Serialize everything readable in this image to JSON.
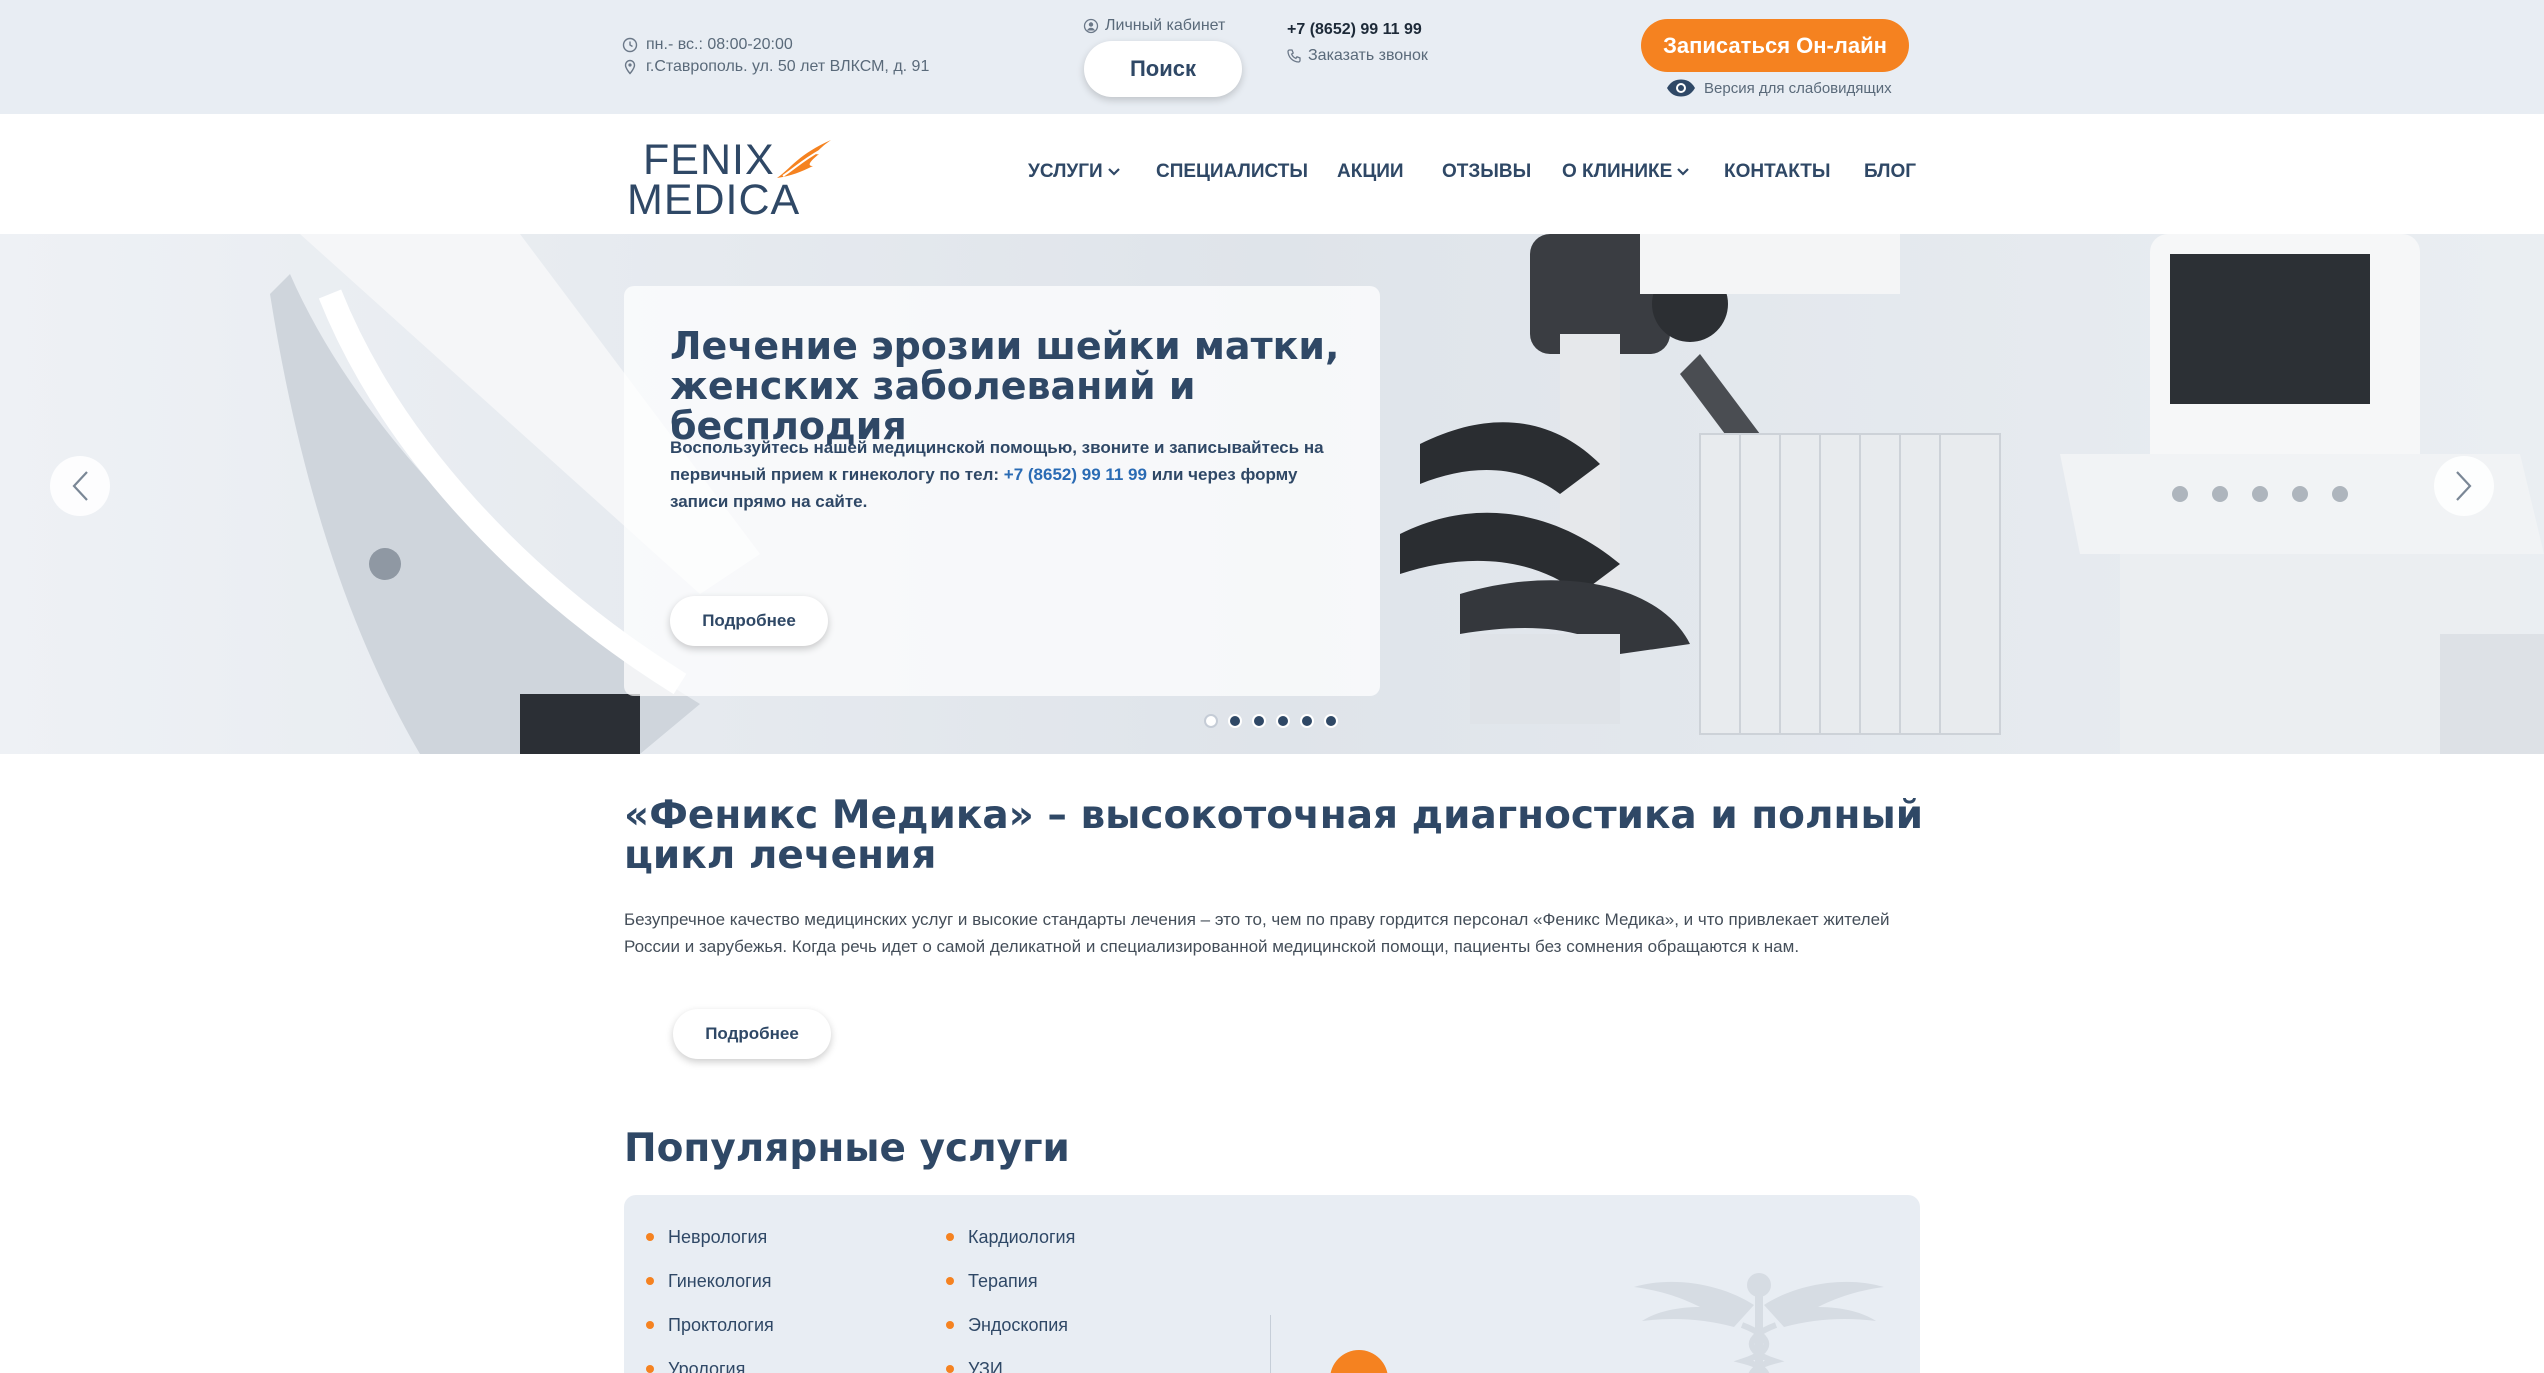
{
  "topbar": {
    "hours": "пн.- вс.: 08:00-20:00",
    "address": "г.Ставрополь. ул. 50 лет ВЛКСМ, д. 91",
    "cabinet_label": "Личный кабинет",
    "search_label": "Поиск",
    "phone": "+7 (8652) 99 11 99",
    "callback_label": "Заказать звонок",
    "online_label": "Записаться Он-лайн",
    "vision_label": "Версия для слабовидящих"
  },
  "logo": {
    "line1": "FENIX",
    "line2": "MEDICA"
  },
  "nav": {
    "items": [
      {
        "label": "УСЛУГИ"
      },
      {
        "label": "СПЕЦИАЛИСТЫ"
      },
      {
        "label": "АКЦИИ"
      },
      {
        "label": "ОТЗЫВЫ"
      },
      {
        "label": "О КЛИНИКЕ"
      },
      {
        "label": "КОНТАКТЫ"
      },
      {
        "label": "БЛОГ"
      }
    ]
  },
  "hero": {
    "title": "Лечение эрозии шейки матки, женских заболеваний и бесплодия",
    "text_before": "Воспользуйтесь нашей медицинской помощью, звоните и записывайтесь на первичный прием к гинекологу по тел: ",
    "phone_link": "+7 (8652) 99 11 99",
    "text_after": " или через форму записи прямо на сайте.",
    "more_label": "Подробнее",
    "slides_total": 6,
    "active_slide": 1
  },
  "about": {
    "title": "«Феникс Медика» – высокоточная диагностика и полный цикл лечения",
    "text": "Безупречное качество медицинских услуг и высокие стандарты лечения – это то, чем по праву гордится персонал «Феникс Медика», и что привлекает жителей России и зарубежья. Когда речь идет о самой деликатной и специализированной медицинской помощи, пациенты без сомнения обращаются к нам.",
    "more_label": "Подробнее"
  },
  "services": {
    "title": "Популярные услуги",
    "col1": [
      "Неврология",
      "Гинекология",
      "Проктология",
      "Урология"
    ],
    "col2": [
      "Кардиология",
      "Терапия",
      "Эндоскопия",
      "УЗИ"
    ]
  },
  "colors": {
    "accent": "#f58220",
    "primary": "#2f4866",
    "topbar_bg": "#e8edf3"
  }
}
